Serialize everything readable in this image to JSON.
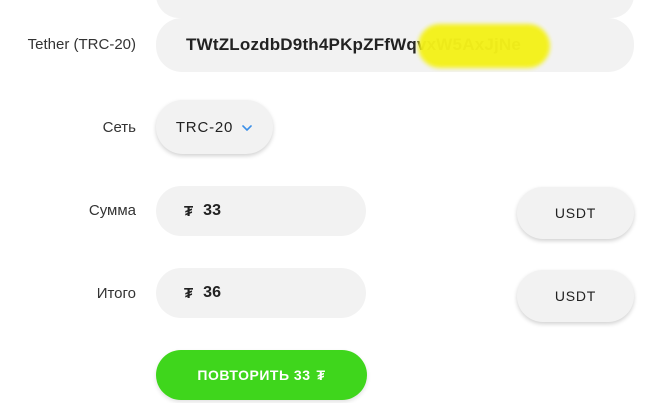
{
  "address": {
    "label": "Tether (TRC-20)",
    "value": "TWtZLozdbD9th4PKpZFfWqvxW5AxJjNe"
  },
  "network": {
    "label": "Сеть",
    "value": "TRC-20",
    "icon": "chevron-down-icon",
    "accent_color": "#3b8fe8"
  },
  "amount": {
    "label": "Сумма",
    "symbol": "₮",
    "value": "33",
    "currency": "USDT"
  },
  "total": {
    "label": "Итого",
    "symbol": "₮",
    "value": "36",
    "currency": "USDT"
  },
  "repeat_button": {
    "label": "ПОВТОРИТЬ 33",
    "symbol": "₮",
    "color": "#3fd61c"
  }
}
